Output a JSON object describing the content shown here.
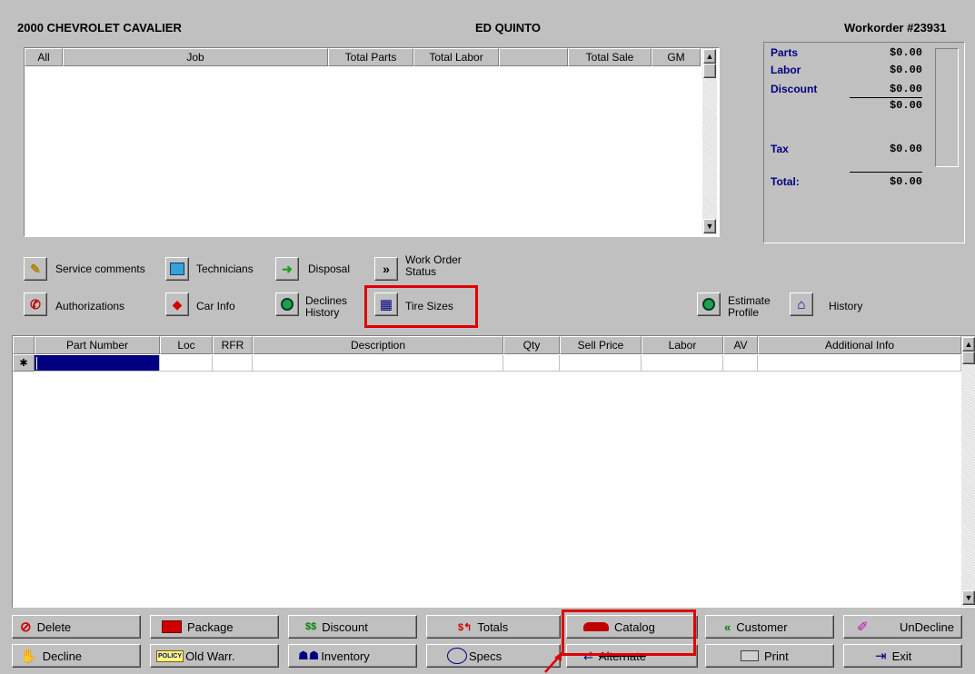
{
  "header": {
    "vehicle": "2000 CHEVROLET CAVALIER",
    "customer": "ED QUINTO",
    "workorder": "Workorder #23931"
  },
  "jobs_table": {
    "columns": [
      "All",
      "Job",
      "Total Parts",
      "Total Labor",
      "",
      "Total Sale",
      "GM"
    ],
    "rows": []
  },
  "totals": {
    "parts_label": "Parts",
    "parts_value": "$0.00",
    "labor_label": "Labor",
    "labor_value": "$0.00",
    "discount_label": "Discount",
    "discount_value": "$0.00",
    "subtotal_value": "$0.00",
    "tax_label": "Tax",
    "tax_value": "$0.00",
    "total_label": "Total:",
    "total_value": "$0.00"
  },
  "toolbar": {
    "service_comments": "Service comments",
    "technicians": "Technicians",
    "disposal": "Disposal",
    "work_order_status": "Work Order Status",
    "authorizations": "Authorizations",
    "car_info": "Car Info",
    "declines_history": "Declines History",
    "tire_sizes": "Tire Sizes",
    "estimate_profile": "Estimate Profile",
    "history": "History"
  },
  "parts_table": {
    "columns": [
      "Part Number",
      "Loc",
      "RFR",
      "Description",
      "Qty",
      "Sell Price",
      "Labor",
      "AV",
      "Additional Info"
    ],
    "new_row_marker": "✱"
  },
  "bottom_buttons": {
    "delete": "Delete",
    "package": "Package",
    "discount": "Discount",
    "totals": "Totals",
    "catalog": "Catalog",
    "customer": "Customer",
    "undecline": "UnDecline",
    "decline": "Decline",
    "old_warr": "Old Warr.",
    "inventory": "Inventory",
    "specs": "Specs",
    "alternate": "Alternate",
    "print": "Print",
    "exit": "Exit"
  },
  "icons": {
    "discount_glyph": "$$",
    "totals_glyph": "$↰",
    "customer_glyph": "«",
    "policy_text": "POLICY"
  },
  "colors": {
    "highlight": "#e00000",
    "label_blue": "#000080",
    "selection": "#000080"
  }
}
